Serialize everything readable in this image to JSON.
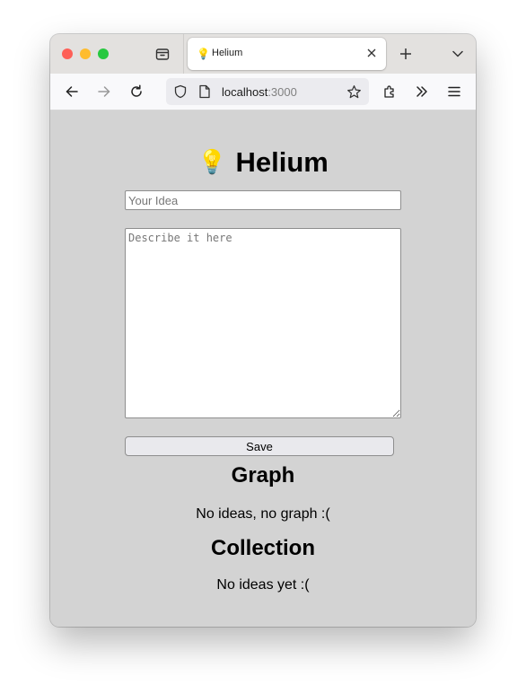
{
  "browser": {
    "tab": {
      "favicon": "💡",
      "title": "Helium"
    },
    "urlbar": {
      "host": "localhost",
      "port": ":3000"
    },
    "icons": {
      "tabs_menu": "tabs-menu-icon",
      "close": "close-icon",
      "new_tab": "plus-icon",
      "list_tabs": "chevron-down-icon",
      "back": "arrow-left-icon",
      "forward": "arrow-right-icon",
      "reload": "reload-icon",
      "shield": "shield-icon",
      "page": "page-icon",
      "bookmark": "star-icon",
      "extensions": "puzzle-icon",
      "overflow": "double-chevron-icon",
      "menu": "hamburger-icon"
    }
  },
  "page": {
    "title_icon": "💡",
    "title": "Helium",
    "idea_placeholder": "Your Idea",
    "description_placeholder": "Describe it here",
    "save_label": "Save",
    "graph_heading": "Graph",
    "graph_empty": "No ideas, no graph :(",
    "collection_heading": "Collection",
    "collection_empty": "No ideas yet :("
  }
}
